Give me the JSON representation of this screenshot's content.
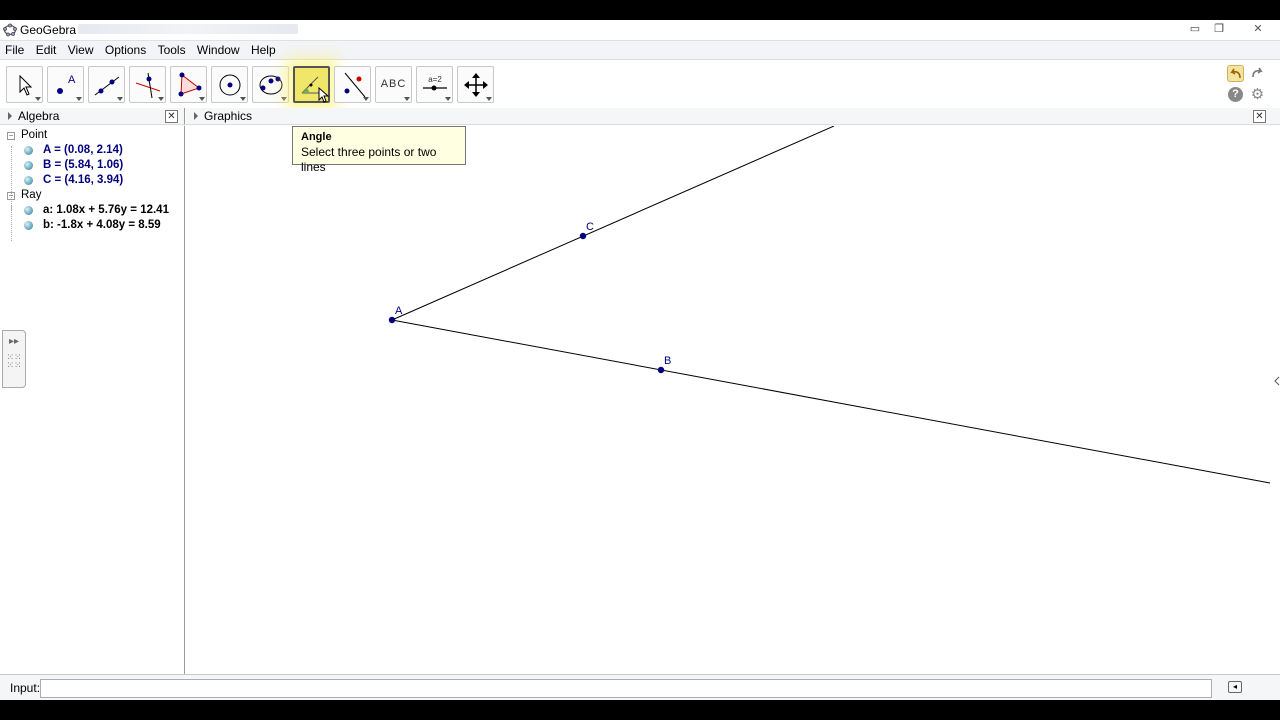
{
  "window": {
    "title": "GeoGebra"
  },
  "window_controls": [
    "minimize-icon",
    "restore-icon",
    "close-icon"
  ],
  "menu": [
    "File",
    "Edit",
    "View",
    "Options",
    "Tools",
    "Window",
    "Help"
  ],
  "toolbar": {
    "tools": [
      {
        "name": "move-tool",
        "icon": "cursor-arrow-icon"
      },
      {
        "name": "point-tool",
        "icon": "point-icon",
        "label": "A"
      },
      {
        "name": "line-tool",
        "icon": "line-icon"
      },
      {
        "name": "perpendicular-tool",
        "icon": "perpendicular-icon"
      },
      {
        "name": "polygon-tool",
        "icon": "polygon-icon"
      },
      {
        "name": "circle-tool",
        "icon": "circle-icon"
      },
      {
        "name": "conic-tool",
        "icon": "ellipse-icon"
      },
      {
        "name": "angle-tool",
        "icon": "angle-icon",
        "active": true
      },
      {
        "name": "reflect-tool",
        "icon": "reflect-icon"
      },
      {
        "name": "text-tool",
        "icon": "text-icon",
        "label": "ABC"
      },
      {
        "name": "slider-tool",
        "icon": "slider-icon",
        "label": "a=2"
      },
      {
        "name": "move-view-tool",
        "icon": "move-view-icon"
      }
    ]
  },
  "tooltip": {
    "title": "Angle",
    "description": "Select three points or two lines"
  },
  "algebra": {
    "header": "Algebra",
    "groups": [
      {
        "label": "Point",
        "items": [
          "A = (0.08, 2.14)",
          "B = (5.84, 1.06)",
          "C = (4.16, 3.94)"
        ]
      },
      {
        "label": "Ray",
        "items": [
          "a: 1.08x + 5.76y = 12.41",
          "b: -1.8x + 4.08y = 8.59"
        ]
      }
    ]
  },
  "graphics": {
    "header": "Graphics",
    "points": [
      {
        "label": "A"
      },
      {
        "label": "B"
      },
      {
        "label": "C"
      }
    ],
    "colors": {
      "point": "#00007f",
      "line": "#000000",
      "accent": "#f0e76a"
    }
  },
  "input": {
    "label": "Input:",
    "value": ""
  }
}
